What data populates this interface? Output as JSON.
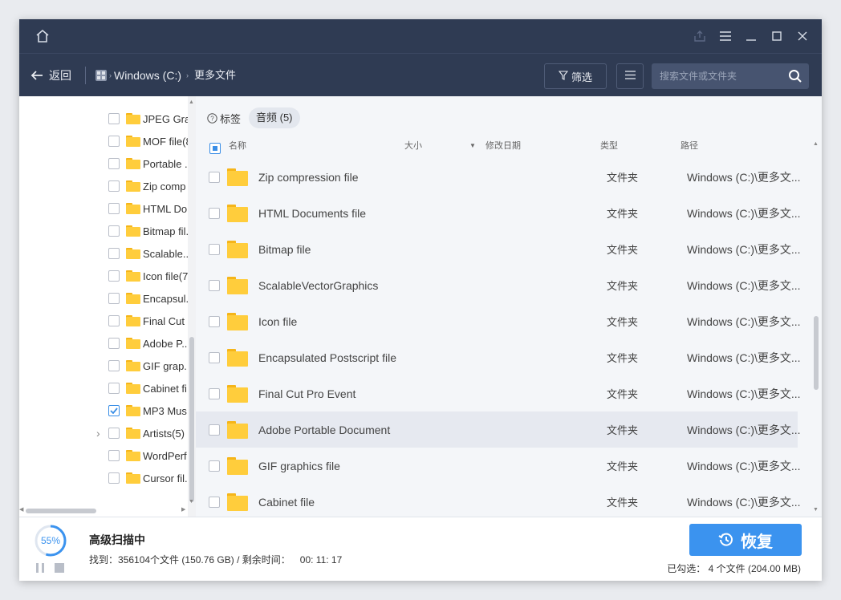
{
  "navbar": {
    "back_label": "返回",
    "breadcrumb": [
      "Windows (C:)",
      "更多文件"
    ],
    "filter_label": "筛选",
    "search_placeholder": "搜索文件或文件夹"
  },
  "tree": {
    "items": [
      {
        "label": "JPEG Gra...",
        "checked": false
      },
      {
        "label": "MOF file(8",
        "checked": false
      },
      {
        "label": "Portable ...",
        "checked": false
      },
      {
        "label": "Zip comp",
        "checked": false
      },
      {
        "label": "HTML Do",
        "checked": false
      },
      {
        "label": "Bitmap fil...",
        "checked": false
      },
      {
        "label": "Scalable...",
        "checked": false
      },
      {
        "label": "Icon file(7",
        "checked": false
      },
      {
        "label": "Encapsul...",
        "checked": false
      },
      {
        "label": "Final Cut ...",
        "checked": false
      },
      {
        "label": "Adobe P...",
        "checked": false
      },
      {
        "label": "GIF grap...",
        "checked": false
      },
      {
        "label": "Cabinet fi",
        "checked": false
      },
      {
        "label": "MP3 Mus",
        "checked": true
      },
      {
        "label": "Artists(5)",
        "checked": false,
        "expandable": true
      },
      {
        "label": "WordPerf",
        "checked": false
      },
      {
        "label": "Cursor fil...",
        "checked": false
      }
    ]
  },
  "list": {
    "tags_label": "标签",
    "tag_chip": "音频 (5)",
    "columns": {
      "name": "名称",
      "size": "大小",
      "date": "修改日期",
      "type": "类型",
      "path": "路径"
    },
    "rows": [
      {
        "name": "Zip compression file",
        "type": "文件夹",
        "path": "Windows (C:)\\更多文..."
      },
      {
        "name": "HTML Documents file",
        "type": "文件夹",
        "path": "Windows (C:)\\更多文..."
      },
      {
        "name": "Bitmap file",
        "type": "文件夹",
        "path": "Windows (C:)\\更多文..."
      },
      {
        "name": "ScalableVectorGraphics",
        "type": "文件夹",
        "path": "Windows (C:)\\更多文..."
      },
      {
        "name": "Icon file",
        "type": "文件夹",
        "path": "Windows (C:)\\更多文..."
      },
      {
        "name": "Encapsulated Postscript file",
        "type": "文件夹",
        "path": "Windows (C:)\\更多文..."
      },
      {
        "name": "Final Cut Pro Event",
        "type": "文件夹",
        "path": "Windows (C:)\\更多文..."
      },
      {
        "name": "Adobe Portable Document",
        "type": "文件夹",
        "path": "Windows (C:)\\更多文...",
        "highlighted": true
      },
      {
        "name": "GIF graphics file",
        "type": "文件夹",
        "path": "Windows (C:)\\更多文..."
      },
      {
        "name": "Cabinet file",
        "type": "文件夹",
        "path": "Windows (C:)\\更多文..."
      }
    ]
  },
  "footer": {
    "progress_percent_label": "55%",
    "progress_fraction": 0.55,
    "status_title": "高级扫描中",
    "found_label": "找到：",
    "found_value": "356104个文件 (150.76 GB)",
    "remaining_label": " / 剩余时间：",
    "remaining_value": "00: 11: 17",
    "recover_label": "恢复",
    "selected_summary": "已勾选：  4 个文件 (204.00 MB)"
  },
  "colors": {
    "titlebar": "#2f3b53",
    "accent": "#3b93ef",
    "folder": "#ffcd3c"
  }
}
